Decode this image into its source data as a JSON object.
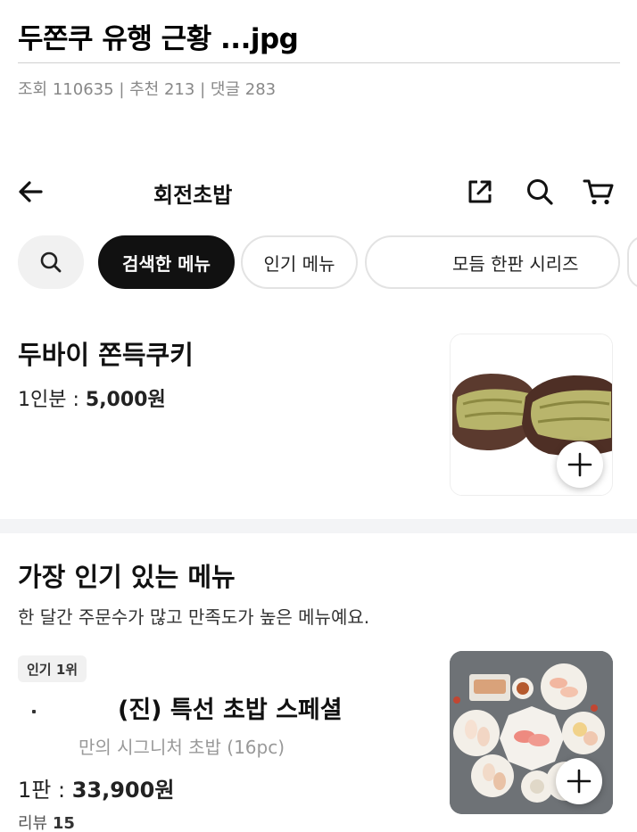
{
  "post": {
    "title": "두쫀쿠 유행 근황 ...jpg",
    "views_label": "조회",
    "views": "110635",
    "recommend_label": "추천",
    "recommend": "213",
    "comments_label": "댓글",
    "comments": "283"
  },
  "header": {
    "store_name": "회전초밥",
    "icons": [
      "back-arrow-icon",
      "share-icon",
      "search-icon",
      "cart-icon"
    ]
  },
  "chips": {
    "search_icon": "search-icon",
    "active": "검색한 메뉴",
    "popular": "인기 메뉴",
    "series": "모듬 한판 시리즈"
  },
  "item1": {
    "name": "두바이 쫀득쿠키",
    "price_label": "1인분 : ",
    "price": "5,000원"
  },
  "popular_section": {
    "title": "가장 인기 있는 메뉴",
    "subtitle": "한 달간 주문수가 많고 만족도가 높은 메뉴예요."
  },
  "item2": {
    "rank_badge": "인기 1위",
    "name": "(진) 특선 초밥 스페셜",
    "description": "만의 시그니처 초밥 (16pc)",
    "price_label": "1판 : ",
    "price": "33,900원",
    "reviews_label": "리뷰",
    "reviews": "15"
  },
  "colors": {
    "active_chip": "#111111",
    "divider": "#f3f4f6",
    "muted_text": "#888888"
  }
}
